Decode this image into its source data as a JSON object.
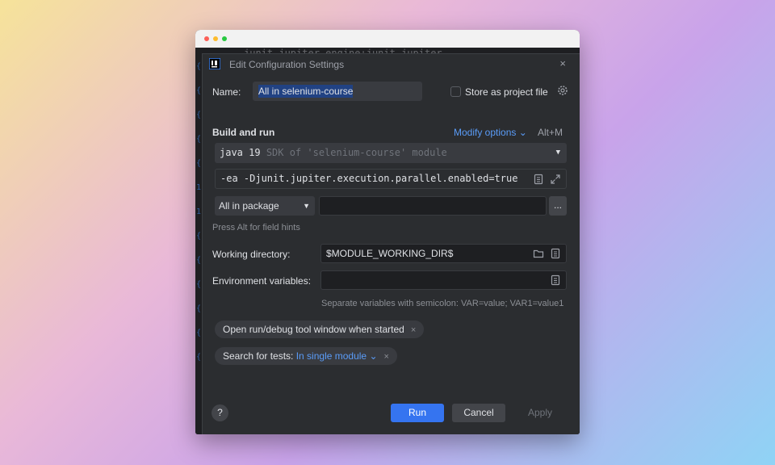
{
  "window": {
    "background_code": "junit.jupiter.engine:junit-jupiter",
    "gutter_marks": [
      "{",
      "{",
      "{",
      "{",
      "{",
      "1",
      "1",
      "{",
      "{",
      "{",
      "{",
      "{",
      "{"
    ]
  },
  "dialog": {
    "title": "Edit Configuration Settings",
    "close_glyph": "×"
  },
  "name": {
    "label": "Name:",
    "value": "All in selenium-course"
  },
  "store_project": {
    "label": "Store as project file",
    "checked": false
  },
  "build_run": {
    "section_label": "Build and run",
    "modify_options": "Modify options",
    "modify_chevron": "⌄",
    "shortcut": "Alt+M",
    "jdk_name": "java 19",
    "jdk_detail": "SDK of 'selenium-course' module",
    "dropdown_arrow": "▼",
    "vm_options": "-ea -Djunit.jupiter.execution.parallel.enabled=true",
    "test_kind": "All in package",
    "package_value": "",
    "browse_label": "...",
    "field_hint": "Press Alt for field hints"
  },
  "working_directory": {
    "label": "Working directory:",
    "value": "$MODULE_WORKING_DIR$"
  },
  "environment": {
    "label": "Environment variables:",
    "value": "",
    "hint": "Separate variables with semicolon: VAR=value; VAR1=value1"
  },
  "chips": {
    "open_tool_window": "Open run/debug tool window when started",
    "search_tests_label": "Search for tests:",
    "search_tests_value": "In single module",
    "search_tests_chevron": "⌄",
    "remove_glyph": "×"
  },
  "footer": {
    "help": "?",
    "run": "Run",
    "cancel": "Cancel",
    "apply": "Apply"
  },
  "colors": {
    "accent": "#3574f0",
    "link": "#5a9cf8",
    "dialog_bg": "#2b2d30"
  }
}
